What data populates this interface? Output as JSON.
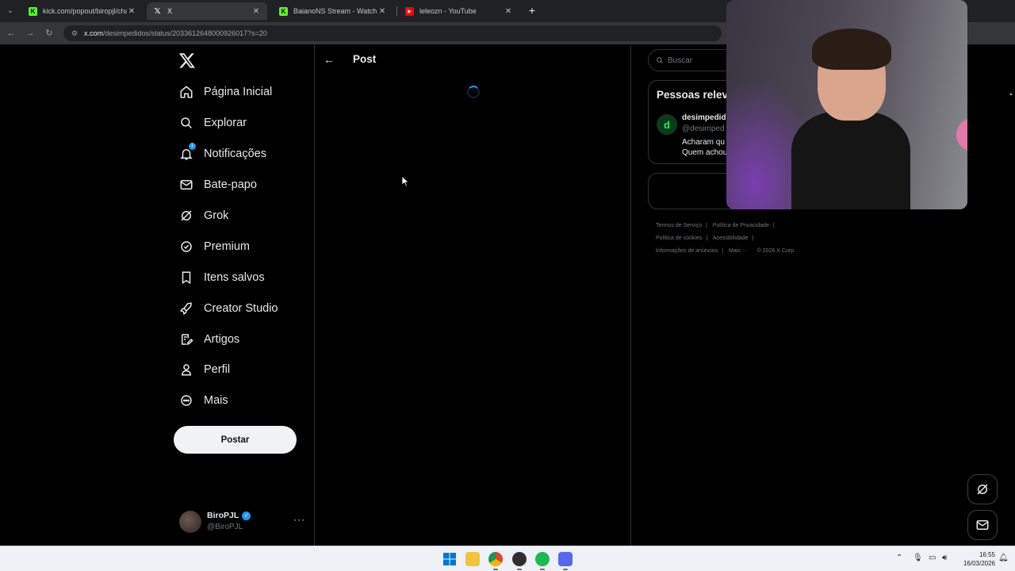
{
  "browser": {
    "tabs": [
      {
        "title": "kick.com/popout/biropjl/chat",
        "favicon": "kick-icon",
        "color": "#53fc18"
      },
      {
        "title": "X",
        "favicon": "x-icon",
        "color": "#ffffff"
      },
      {
        "title": "BaianoNS Stream - Watch Live o",
        "favicon": "kick-icon",
        "color": "#53fc18"
      },
      {
        "title": "leleozn - YouTube",
        "favicon": "youtube-icon",
        "color": "#ff0000"
      }
    ],
    "url_host": "x.com",
    "url_path": "/desimpedidos/status/2033612648000926017?s=20"
  },
  "sidebar": {
    "items": [
      {
        "label": "Página Inicial",
        "icon": "home-icon"
      },
      {
        "label": "Explorar",
        "icon": "search-icon"
      },
      {
        "label": "Notificações",
        "icon": "bell-icon",
        "badge": "1"
      },
      {
        "label": "Bate-papo",
        "icon": "mail-icon"
      },
      {
        "label": "Grok",
        "icon": "grok-icon"
      },
      {
        "label": "Premium",
        "icon": "premium-icon"
      },
      {
        "label": "Itens salvos",
        "icon": "bookmark-icon"
      },
      {
        "label": "Creator Studio",
        "icon": "rocket-icon"
      },
      {
        "label": "Artigos",
        "icon": "article-icon"
      },
      {
        "label": "Perfil",
        "icon": "person-icon"
      },
      {
        "label": "Mais",
        "icon": "more-circle-icon"
      }
    ],
    "post_button": "Postar",
    "account": {
      "name": "BiroPJL",
      "handle": "@BiroPJL"
    }
  },
  "main": {
    "title": "Post"
  },
  "right": {
    "search_placeholder": "Buscar",
    "relevant": {
      "title": "Pessoas relev",
      "name": "desimpedid",
      "handle": "@desimped",
      "bio_line1": "Acharam qu",
      "bio_line2": "Quem achou"
    },
    "footer": {
      "terms": "Termos de Serviço",
      "privacy": "Política de Privacidade",
      "cookies": "Política de cookies",
      "accessibility": "Acessibilidade",
      "ads": "Informações de anúncios",
      "more": "Mais ···",
      "copyright": "© 2026 X Corp."
    }
  },
  "taskbar": {
    "time": "16:55",
    "date": "16/03/2026"
  },
  "colors": {
    "accent": "#1d9bf0",
    "background": "#000000",
    "border": "#2f3336"
  }
}
